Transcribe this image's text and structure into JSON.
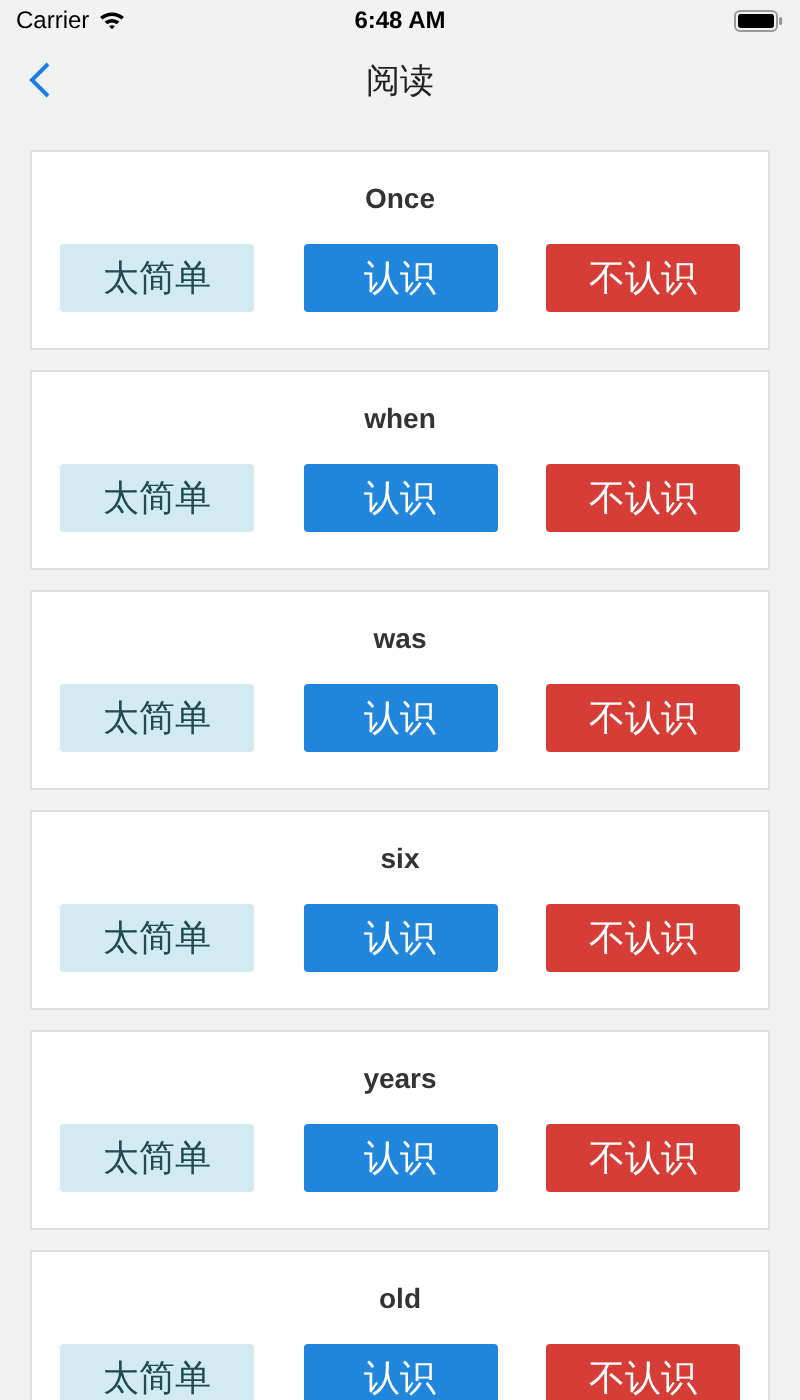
{
  "status_bar": {
    "carrier": "Carrier",
    "time": "6:48 AM"
  },
  "nav": {
    "title": "阅读"
  },
  "cards": [
    {
      "word": "Once",
      "buttons": [
        {
          "label": "太简单",
          "kind": "easy"
        },
        {
          "label": "认识",
          "kind": "know"
        },
        {
          "label": "不认识",
          "kind": "unknown"
        }
      ]
    },
    {
      "word": "when",
      "buttons": [
        {
          "label": "太简单",
          "kind": "easy"
        },
        {
          "label": "认识",
          "kind": "know"
        },
        {
          "label": "不认识",
          "kind": "unknown"
        }
      ]
    },
    {
      "word": "was",
      "buttons": [
        {
          "label": "太简单",
          "kind": "easy"
        },
        {
          "label": "认识",
          "kind": "know"
        },
        {
          "label": "不认识",
          "kind": "unknown"
        }
      ]
    },
    {
      "word": "six",
      "buttons": [
        {
          "label": "太简单",
          "kind": "easy"
        },
        {
          "label": "认识",
          "kind": "know"
        },
        {
          "label": "不认识",
          "kind": "unknown"
        }
      ]
    },
    {
      "word": "years",
      "buttons": [
        {
          "label": "太简单",
          "kind": "easy"
        },
        {
          "label": "认识",
          "kind": "know"
        },
        {
          "label": "不认识",
          "kind": "unknown"
        }
      ]
    },
    {
      "word": "old",
      "buttons": [
        {
          "label": "太简单",
          "kind": "easy"
        },
        {
          "label": "认识",
          "kind": "know"
        },
        {
          "label": "不认识",
          "kind": "unknown"
        }
      ]
    }
  ]
}
